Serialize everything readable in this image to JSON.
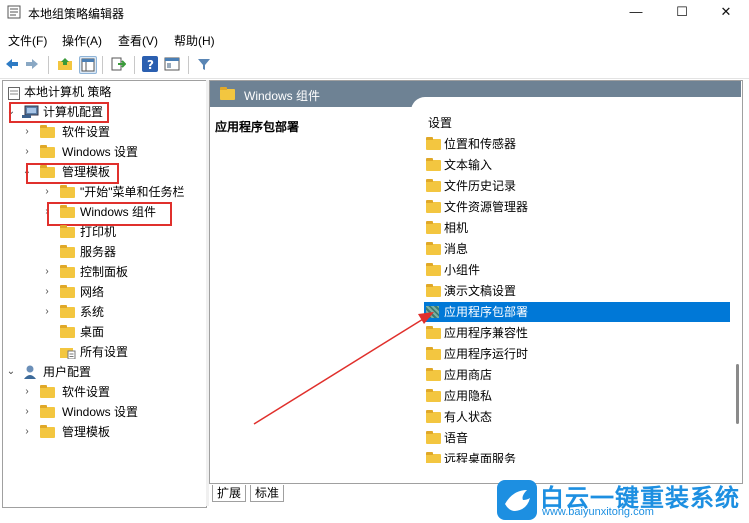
{
  "window": {
    "title": "本地组策略编辑器",
    "controls": {
      "minimize": "—",
      "maximize": "☐",
      "close": "✕"
    }
  },
  "menu": [
    "文件(F)",
    "操作(A)",
    "查看(V)",
    "帮助(H)"
  ],
  "toolbar": {
    "icons": [
      "back-arrow-icon",
      "forward-arrow-icon",
      "up-folder-icon",
      "show-hide-tree-icon",
      "export-list-icon",
      "help-icon",
      "properties-icon",
      "filter-icon"
    ]
  },
  "tree": {
    "root": "本地计算机 策略",
    "computer_config": "计算机配置",
    "cc_software": "软件设置",
    "cc_windows": "Windows 设置",
    "cc_admin": "管理模板",
    "start_menu": "\"开始\"菜单和任务栏",
    "windows_components": "Windows 组件",
    "printers": "打印机",
    "servers": "服务器",
    "control_panel": "控制面板",
    "network": "网络",
    "system": "系统",
    "desktop": "桌面",
    "all_settings": "所有设置",
    "user_config": "用户配置",
    "uc_software": "软件设置",
    "uc_windows": "Windows 设置",
    "uc_admin": "管理模板"
  },
  "right": {
    "header_title": "Windows 组件",
    "description_title": "应用程序包部署",
    "column_header": "设置",
    "items": [
      "位置和传感器",
      "文本输入",
      "文件历史记录",
      "文件资源管理器",
      "相机",
      "消息",
      "小组件",
      "演示文稿设置",
      "应用程序包部署",
      "应用程序兼容性",
      "应用程序运行时",
      "应用商店",
      "应用隐私",
      "有人状态",
      "语音",
      "远程桌面服务"
    ],
    "selected_item": "应用程序包部署"
  },
  "tabs": [
    "扩展",
    "标准"
  ],
  "watermark": {
    "text": "白云一键重装系统",
    "url": "www.baiyunxitong.com"
  },
  "colors": {
    "selection": "#0078d7",
    "header_bar": "#6e8294",
    "annotation_red": "#e0302c",
    "folder": "#f3c640"
  }
}
